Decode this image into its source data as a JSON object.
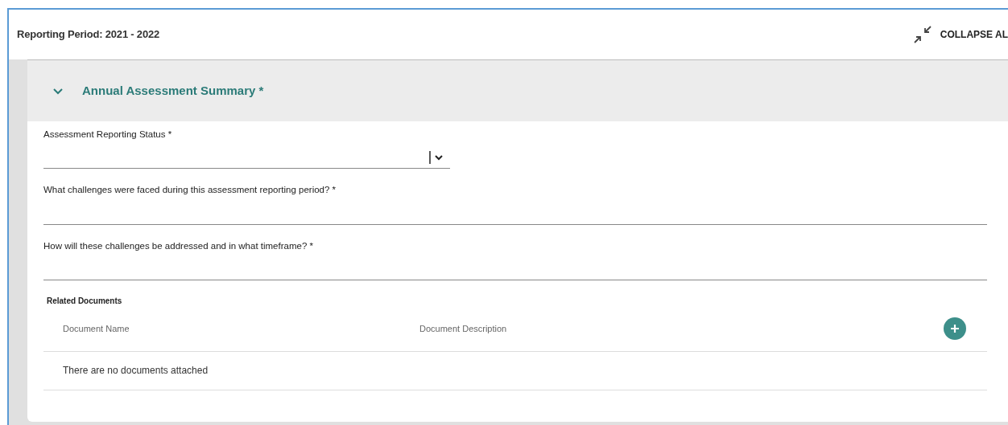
{
  "header": {
    "title": "Reporting Period: 2021 - 2022",
    "collapse_all": "COLLAPSE AL"
  },
  "section": {
    "title": "Annual Assessment Summary *",
    "expanded": true,
    "fields": [
      {
        "kind": "select",
        "label": "Assessment Reporting Status *"
      },
      {
        "kind": "text",
        "label": "What challenges were faced during this assessment reporting period? *"
      },
      {
        "kind": "text",
        "label": "How will these challenges be addressed and in what timeframe? *"
      }
    ],
    "documents": {
      "title": "Related Documents",
      "columns": [
        "Document Name",
        "Document Description"
      ],
      "empty_message": "There are no documents attached"
    }
  }
}
